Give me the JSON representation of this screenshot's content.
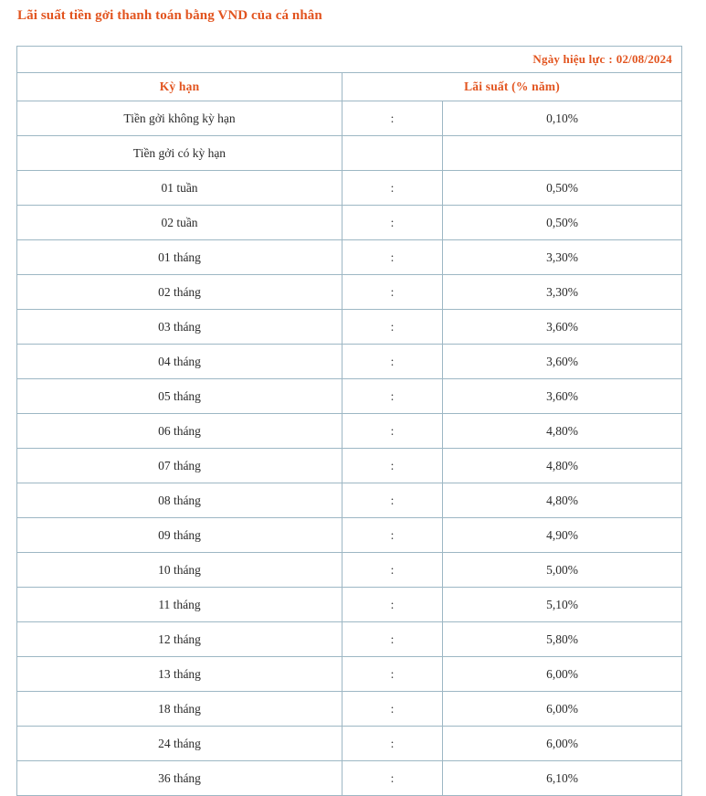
{
  "document": {
    "title": "Lãi suất tiền gởi thanh toán bằng VND của cá nhân",
    "accent_color": "#E2541F",
    "border_color": "#9DB7C4",
    "text_color": "#2A2A2A"
  },
  "effective_date": {
    "label": "Ngày hiệu lực",
    "separator": ":",
    "value": "02/08/2024"
  },
  "table": {
    "headers": {
      "term": "Kỳ hạn",
      "rate": "Lãi  suất (% năm)"
    },
    "colon": ":",
    "rows": [
      {
        "term": "Tiền gởi không kỳ hạn",
        "colon": ":",
        "rate": "0,10%",
        "is_group": false
      },
      {
        "term": "Tiền gởi có kỳ hạn",
        "colon": "",
        "rate": "",
        "is_group": true
      },
      {
        "term": "01 tuần",
        "colon": ":",
        "rate": "0,50%",
        "is_group": false
      },
      {
        "term": "02 tuần",
        "colon": ":",
        "rate": "0,50%",
        "is_group": false
      },
      {
        "term": "01 tháng",
        "colon": ":",
        "rate": "3,30%",
        "is_group": false
      },
      {
        "term": "02 tháng",
        "colon": ":",
        "rate": "3,30%",
        "is_group": false
      },
      {
        "term": "03 tháng",
        "colon": ":",
        "rate": "3,60%",
        "is_group": false
      },
      {
        "term": "04 tháng",
        "colon": ":",
        "rate": "3,60%",
        "is_group": false
      },
      {
        "term": "05 tháng",
        "colon": ":",
        "rate": "3,60%",
        "is_group": false
      },
      {
        "term": "06 tháng",
        "colon": ":",
        "rate": "4,80%",
        "is_group": false
      },
      {
        "term": "07 tháng",
        "colon": ":",
        "rate": "4,80%",
        "is_group": false
      },
      {
        "term": "08 tháng",
        "colon": ":",
        "rate": "4,80%",
        "is_group": false
      },
      {
        "term": "09 tháng",
        "colon": ":",
        "rate": "4,90%",
        "is_group": false
      },
      {
        "term": "10 tháng",
        "colon": ":",
        "rate": "5,00%",
        "is_group": false
      },
      {
        "term": "11 tháng",
        "colon": ":",
        "rate": "5,10%",
        "is_group": false
      },
      {
        "term": "12 tháng",
        "colon": ":",
        "rate": "5,80%",
        "is_group": false
      },
      {
        "term": "13 tháng",
        "colon": ":",
        "rate": "6,00%",
        "is_group": false
      },
      {
        "term": "18 tháng",
        "colon": ":",
        "rate": "6,00%",
        "is_group": false
      },
      {
        "term": "24 tháng",
        "colon": ":",
        "rate": "6,00%",
        "is_group": false
      },
      {
        "term": "36 tháng",
        "colon": ":",
        "rate": "6,10%",
        "is_group": false
      }
    ]
  },
  "chart_data": {
    "type": "table",
    "title": "Lãi suất tiền gởi thanh toán bằng VND của cá nhân",
    "xlabel": "Kỳ hạn",
    "ylabel": "Lãi suất (% năm)",
    "categories": [
      "Tiền gởi không kỳ hạn",
      "01 tuần",
      "02 tuần",
      "01 tháng",
      "02 tháng",
      "03 tháng",
      "04 tháng",
      "05 tháng",
      "06 tháng",
      "07 tháng",
      "08 tháng",
      "09 tháng",
      "10 tháng",
      "11 tháng",
      "12 tháng",
      "13 tháng",
      "18 tháng",
      "24 tháng",
      "36 tháng"
    ],
    "values": [
      0.1,
      0.5,
      0.5,
      3.3,
      3.3,
      3.6,
      3.6,
      3.6,
      4.8,
      4.8,
      4.8,
      4.9,
      5.0,
      5.1,
      5.8,
      6.0,
      6.0,
      6.0,
      6.1
    ],
    "unit": "%/năm",
    "effective_date": "02/08/2024"
  }
}
